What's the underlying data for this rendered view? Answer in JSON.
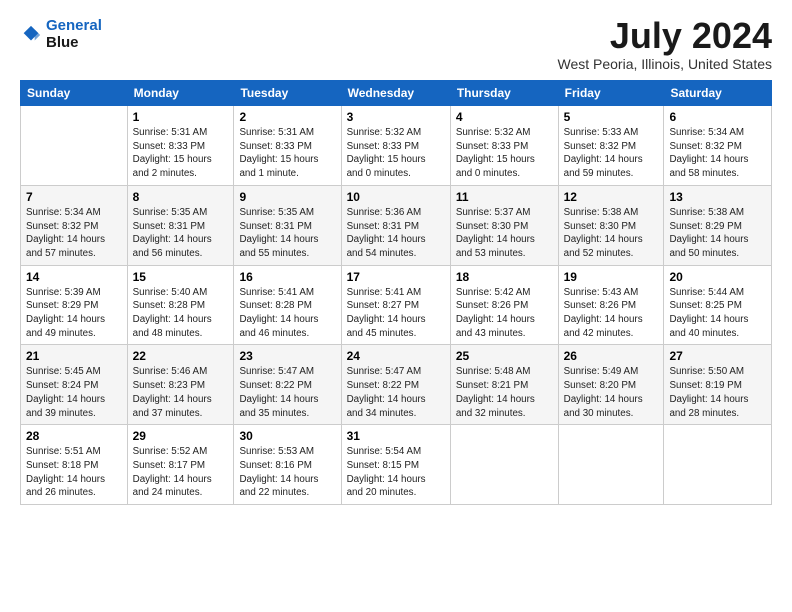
{
  "header": {
    "logo_line1": "General",
    "logo_line2": "Blue",
    "month_year": "July 2024",
    "location": "West Peoria, Illinois, United States"
  },
  "weekdays": [
    "Sunday",
    "Monday",
    "Tuesday",
    "Wednesday",
    "Thursday",
    "Friday",
    "Saturday"
  ],
  "weeks": [
    [
      {
        "day": "",
        "info": ""
      },
      {
        "day": "1",
        "info": "Sunrise: 5:31 AM\nSunset: 8:33 PM\nDaylight: 15 hours\nand 2 minutes."
      },
      {
        "day": "2",
        "info": "Sunrise: 5:31 AM\nSunset: 8:33 PM\nDaylight: 15 hours\nand 1 minute."
      },
      {
        "day": "3",
        "info": "Sunrise: 5:32 AM\nSunset: 8:33 PM\nDaylight: 15 hours\nand 0 minutes."
      },
      {
        "day": "4",
        "info": "Sunrise: 5:32 AM\nSunset: 8:33 PM\nDaylight: 15 hours\nand 0 minutes."
      },
      {
        "day": "5",
        "info": "Sunrise: 5:33 AM\nSunset: 8:32 PM\nDaylight: 14 hours\nand 59 minutes."
      },
      {
        "day": "6",
        "info": "Sunrise: 5:34 AM\nSunset: 8:32 PM\nDaylight: 14 hours\nand 58 minutes."
      }
    ],
    [
      {
        "day": "7",
        "info": "Sunrise: 5:34 AM\nSunset: 8:32 PM\nDaylight: 14 hours\nand 57 minutes."
      },
      {
        "day": "8",
        "info": "Sunrise: 5:35 AM\nSunset: 8:31 PM\nDaylight: 14 hours\nand 56 minutes."
      },
      {
        "day": "9",
        "info": "Sunrise: 5:35 AM\nSunset: 8:31 PM\nDaylight: 14 hours\nand 55 minutes."
      },
      {
        "day": "10",
        "info": "Sunrise: 5:36 AM\nSunset: 8:31 PM\nDaylight: 14 hours\nand 54 minutes."
      },
      {
        "day": "11",
        "info": "Sunrise: 5:37 AM\nSunset: 8:30 PM\nDaylight: 14 hours\nand 53 minutes."
      },
      {
        "day": "12",
        "info": "Sunrise: 5:38 AM\nSunset: 8:30 PM\nDaylight: 14 hours\nand 52 minutes."
      },
      {
        "day": "13",
        "info": "Sunrise: 5:38 AM\nSunset: 8:29 PM\nDaylight: 14 hours\nand 50 minutes."
      }
    ],
    [
      {
        "day": "14",
        "info": "Sunrise: 5:39 AM\nSunset: 8:29 PM\nDaylight: 14 hours\nand 49 minutes."
      },
      {
        "day": "15",
        "info": "Sunrise: 5:40 AM\nSunset: 8:28 PM\nDaylight: 14 hours\nand 48 minutes."
      },
      {
        "day": "16",
        "info": "Sunrise: 5:41 AM\nSunset: 8:28 PM\nDaylight: 14 hours\nand 46 minutes."
      },
      {
        "day": "17",
        "info": "Sunrise: 5:41 AM\nSunset: 8:27 PM\nDaylight: 14 hours\nand 45 minutes."
      },
      {
        "day": "18",
        "info": "Sunrise: 5:42 AM\nSunset: 8:26 PM\nDaylight: 14 hours\nand 43 minutes."
      },
      {
        "day": "19",
        "info": "Sunrise: 5:43 AM\nSunset: 8:26 PM\nDaylight: 14 hours\nand 42 minutes."
      },
      {
        "day": "20",
        "info": "Sunrise: 5:44 AM\nSunset: 8:25 PM\nDaylight: 14 hours\nand 40 minutes."
      }
    ],
    [
      {
        "day": "21",
        "info": "Sunrise: 5:45 AM\nSunset: 8:24 PM\nDaylight: 14 hours\nand 39 minutes."
      },
      {
        "day": "22",
        "info": "Sunrise: 5:46 AM\nSunset: 8:23 PM\nDaylight: 14 hours\nand 37 minutes."
      },
      {
        "day": "23",
        "info": "Sunrise: 5:47 AM\nSunset: 8:22 PM\nDaylight: 14 hours\nand 35 minutes."
      },
      {
        "day": "24",
        "info": "Sunrise: 5:47 AM\nSunset: 8:22 PM\nDaylight: 14 hours\nand 34 minutes."
      },
      {
        "day": "25",
        "info": "Sunrise: 5:48 AM\nSunset: 8:21 PM\nDaylight: 14 hours\nand 32 minutes."
      },
      {
        "day": "26",
        "info": "Sunrise: 5:49 AM\nSunset: 8:20 PM\nDaylight: 14 hours\nand 30 minutes."
      },
      {
        "day": "27",
        "info": "Sunrise: 5:50 AM\nSunset: 8:19 PM\nDaylight: 14 hours\nand 28 minutes."
      }
    ],
    [
      {
        "day": "28",
        "info": "Sunrise: 5:51 AM\nSunset: 8:18 PM\nDaylight: 14 hours\nand 26 minutes."
      },
      {
        "day": "29",
        "info": "Sunrise: 5:52 AM\nSunset: 8:17 PM\nDaylight: 14 hours\nand 24 minutes."
      },
      {
        "day": "30",
        "info": "Sunrise: 5:53 AM\nSunset: 8:16 PM\nDaylight: 14 hours\nand 22 minutes."
      },
      {
        "day": "31",
        "info": "Sunrise: 5:54 AM\nSunset: 8:15 PM\nDaylight: 14 hours\nand 20 minutes."
      },
      {
        "day": "",
        "info": ""
      },
      {
        "day": "",
        "info": ""
      },
      {
        "day": "",
        "info": ""
      }
    ]
  ]
}
